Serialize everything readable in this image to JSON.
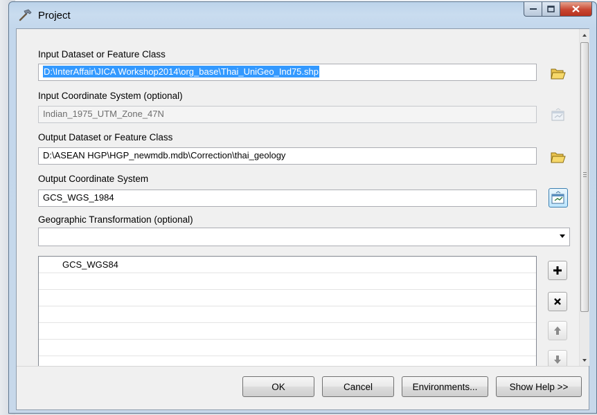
{
  "dialog": {
    "title": "Project",
    "controls": {
      "minimize": "–",
      "maximize": "□",
      "close": "✕"
    }
  },
  "form": {
    "input_dataset": {
      "label": "Input Dataset or Feature Class",
      "value": "D:\\InterAffair\\JICA Workshop2014\\org_base\\Thai_UniGeo_Ind75.shp",
      "selected": true
    },
    "input_coord": {
      "label": "Input Coordinate System (optional)",
      "value": "Indian_1975_UTM_Zone_47N",
      "disabled": true
    },
    "output_dataset": {
      "label": "Output Dataset or Feature Class",
      "value": "D:\\ASEAN HGP\\HGP_newmdb.mdb\\Correction\\thai_geology"
    },
    "output_coord": {
      "label": "Output Coordinate System",
      "value": "GCS_WGS_1984"
    },
    "geo_transform": {
      "label": "Geographic Transformation (optional)",
      "selected": "",
      "list": [
        "GCS_WGS84",
        "",
        "",
        "",
        "",
        "",
        ""
      ]
    }
  },
  "buttons": {
    "ok": "OK",
    "cancel": "Cancel",
    "environments": "Environments...",
    "show_help": "Show Help >>"
  },
  "icons": {
    "browse": "open-folder-icon",
    "coord_props": "coordinate-system-properties-icon",
    "add": "plus-icon",
    "remove": "x-icon",
    "up": "arrow-up-icon",
    "down": "arrow-down-icon"
  },
  "colors": {
    "selection": "#3399ff",
    "title_gradient": "#c3d7ec",
    "close_button": "#c84631"
  }
}
